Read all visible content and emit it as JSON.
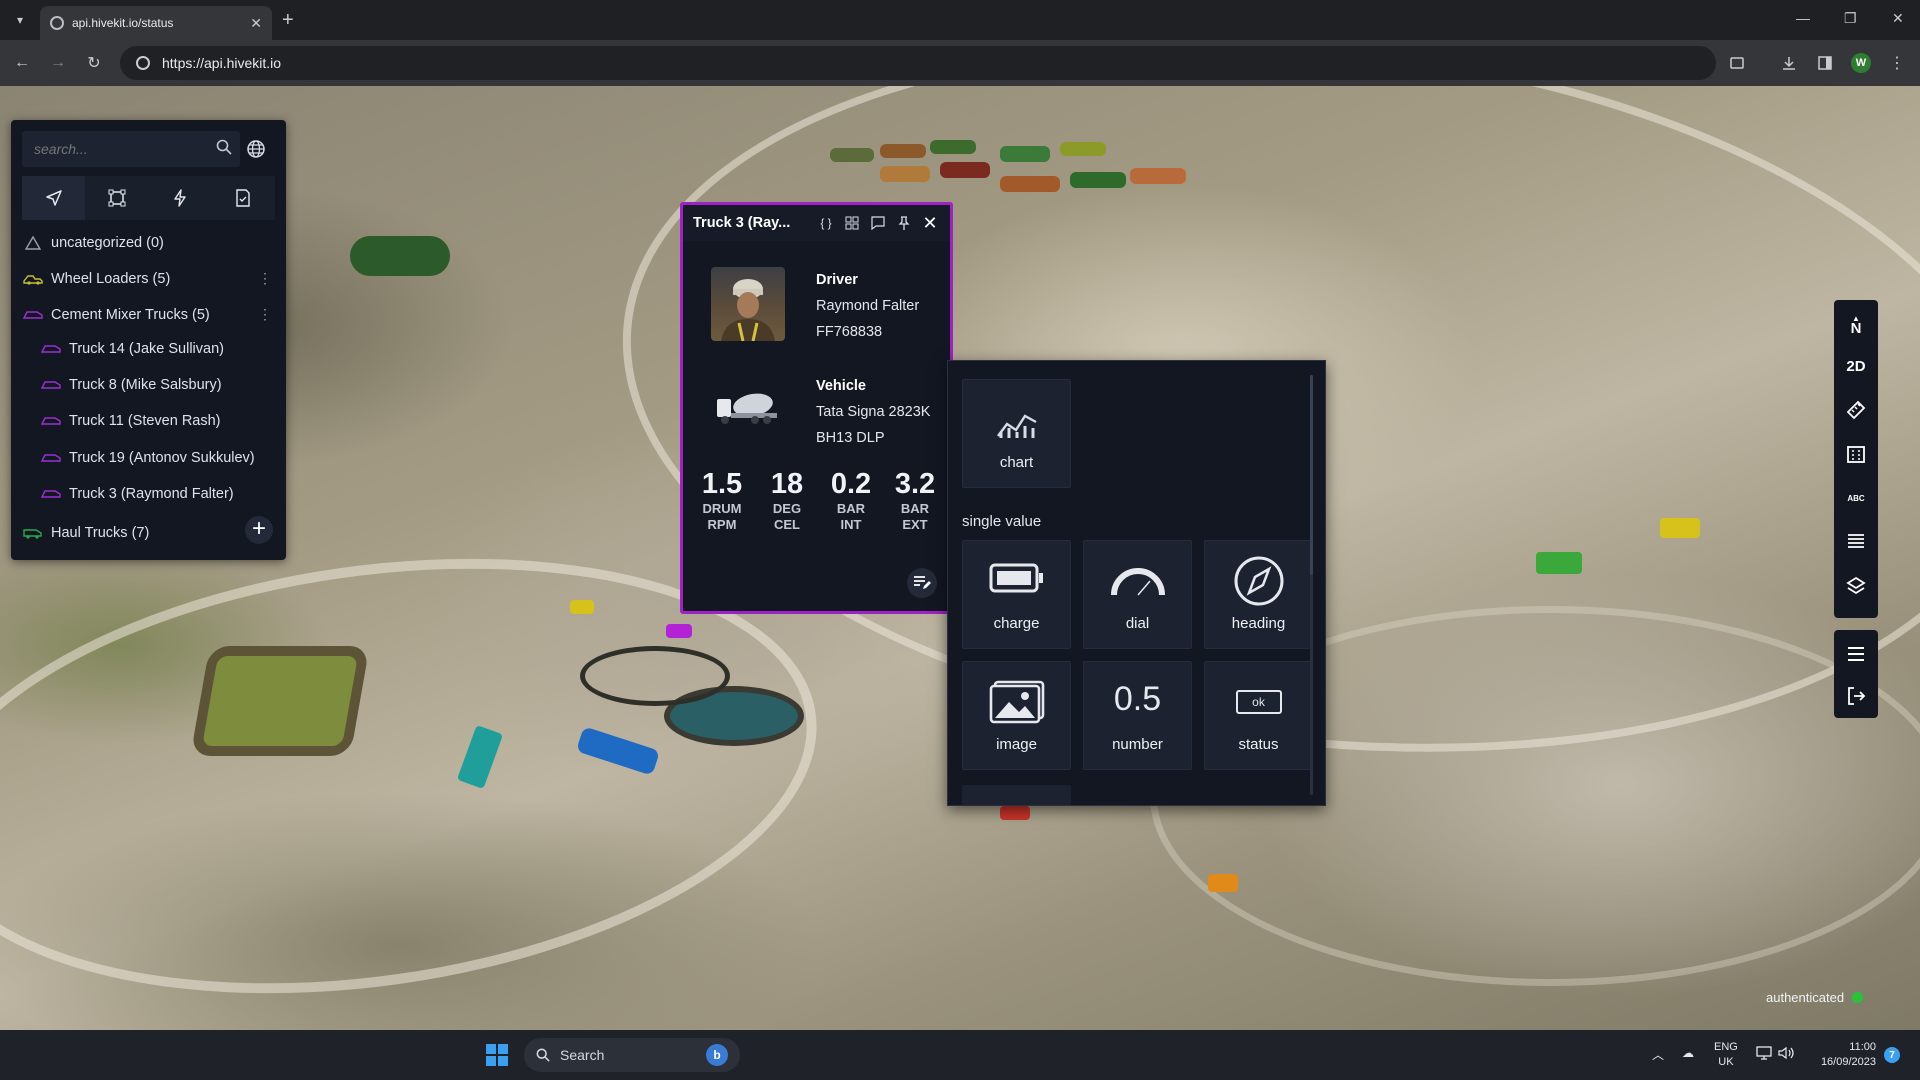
{
  "browser": {
    "tab_title": "api.hivekit.io/status",
    "url": "https://api.hivekit.io",
    "profile_initial": "W"
  },
  "sidebar": {
    "search_placeholder": "search...",
    "tabs": [
      "navigation-icon",
      "area-icon",
      "lightning-icon",
      "task-icon"
    ],
    "items": [
      {
        "label": "uncategorized (0)",
        "icon": "warning-icon",
        "color": "#9aa0ad"
      },
      {
        "label": "Wheel Loaders (5)",
        "icon": "loader-icon",
        "color": "#c8c22a"
      },
      {
        "label": "Cement Mixer Trucks (5)",
        "icon": "mixer-icon",
        "color": "#9b2fd4"
      },
      {
        "label": "Truck 14 (Jake Sullivan)",
        "icon": "mixer-icon",
        "color": "#9b2fd4"
      },
      {
        "label": "Truck 8 (Mike Salsbury)",
        "icon": "mixer-icon",
        "color": "#9b2fd4"
      },
      {
        "label": "Truck 11 (Steven Rash)",
        "icon": "mixer-icon",
        "color": "#9b2fd4"
      },
      {
        "label": "Truck 19 (Antonov Sukkulev)",
        "icon": "mixer-icon",
        "color": "#9b2fd4"
      },
      {
        "label": "Truck 3 (Raymond Falter)",
        "icon": "mixer-icon",
        "color": "#9b2fd4"
      },
      {
        "label": "Haul Trucks (7)",
        "icon": "haul-truck-icon",
        "color": "#2aa84a"
      }
    ],
    "add_label": "+"
  },
  "card": {
    "title": "Truck 3 (Ray...",
    "accent": "#a021c6",
    "driver": {
      "heading": "Driver",
      "name": "Raymond Falter",
      "id": "FF768838"
    },
    "vehicle": {
      "heading": "Vehicle",
      "model": "Tata Signa 2823K",
      "plate": "BH13 DLP"
    },
    "metrics": [
      {
        "value": "1.5",
        "unit1": "DRUM",
        "unit2": "RPM"
      },
      {
        "value": "18",
        "unit1": "DEG",
        "unit2": "CEL"
      },
      {
        "value": "0.2",
        "unit1": "BAR",
        "unit2": "INT"
      },
      {
        "value": "3.2",
        "unit1": "BAR",
        "unit2": "EXT"
      }
    ]
  },
  "picker": {
    "chart_label": "chart",
    "section_label": "single value",
    "tiles": [
      "charge",
      "dial",
      "heading",
      "image",
      "number",
      "status"
    ],
    "number_sample": "0.5",
    "status_sample": "ok"
  },
  "right_toolbar": {
    "north_label": "N",
    "view_label": "2D",
    "abc_label": "ABC"
  },
  "status": {
    "auth_text": "authenticated",
    "auth_color": "#25c43b"
  },
  "taskbar": {
    "search_text": "Search",
    "lang_1": "ENG",
    "lang_2": "UK",
    "time": "11:00",
    "date": "16/09/2023",
    "notifications": "7"
  }
}
